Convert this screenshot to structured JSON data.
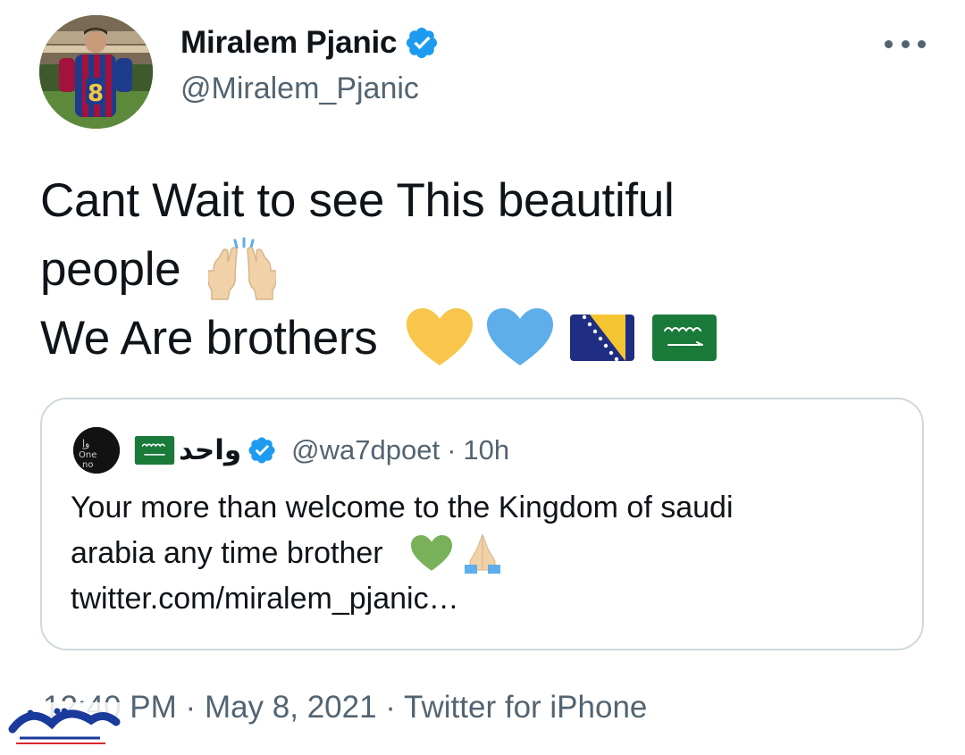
{
  "author": {
    "display_name": "Miralem Pjanic",
    "handle": "@Miralem_Pjanic",
    "verified": true,
    "avatar_icon": "player-avatar"
  },
  "header": {
    "more_icon": "more-horizontal-icon"
  },
  "tweet": {
    "lines": [
      "Cant Wait to see This beautiful",
      "people",
      "We Are brothers"
    ],
    "emojis": [
      "raising-hands-emoji",
      "yellow-heart-emoji",
      "blue-heart-emoji",
      "bosnia-flag-emoji",
      "saudi-flag-emoji"
    ]
  },
  "quote": {
    "display_name": "واحد",
    "handle": "@wa7dpoet",
    "separator": "·",
    "time": "10h",
    "verified": true,
    "lines": [
      "Your more than welcome to the Kingdom of saudi",
      "arabia any time brother"
    ],
    "link": "twitter.com/miralem_pjanic…",
    "emojis": [
      "green-heart-emoji",
      "folded-hands-emoji"
    ]
  },
  "meta": {
    "time": "12:40 PM",
    "separator": "·",
    "date": "May 8, 2021",
    "source": "Twitter for iPhone"
  },
  "colors": {
    "verified_blue": "#1d9bf0",
    "secondary_text": "#536471",
    "border": "#cfd9de",
    "yellow_heart": "#f7c64a",
    "blue_heart": "#5daeea",
    "green_heart": "#78b159",
    "watermark_blue": "#1a3a9c",
    "watermark_red": "#d7282f"
  }
}
